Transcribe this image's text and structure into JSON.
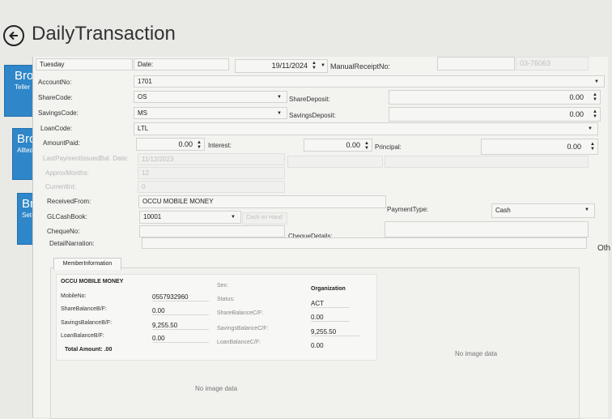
{
  "header": {
    "title": "DailyTransaction"
  },
  "tiles": [
    {
      "big": "Bro",
      "small": "Teller"
    },
    {
      "big": "Bro",
      "small": "Allted"
    },
    {
      "big": "Bro",
      "small": "Set-O"
    }
  ],
  "form": {
    "day": "Tuesday",
    "date_label": "Date:",
    "date_value": "19/11/2024",
    "manual_receipt_label": "ManualReceiptNo:",
    "manual_receipt_value": "",
    "receipt_ref": "03-76063",
    "account_label": "AccountNo:",
    "account_value": "1701",
    "share_code_label": "ShareCode:",
    "share_code_value": "OS",
    "share_deposit_label": "ShareDeposit:",
    "share_deposit_value": "0.00",
    "savings_code_label": "SavingsCode:",
    "savings_code_value": "MS",
    "savings_deposit_label": "SavingsDeposit:",
    "savings_deposit_value": "0.00",
    "loan_code_label": "LoanCode:",
    "loan_code_value": "LTL",
    "amount_paid_label": "AmountPaid:",
    "amount_paid_value": "0.00",
    "interest_label": "Interest:",
    "interest_value": "0.00",
    "principal_label": "Principal:",
    "principal_value": "0.00",
    "last_payment_label": "LastPaymentIssuedBal. Date:",
    "last_payment_value": "11/12/2023",
    "approx_months_label": "ApproxMonths:",
    "approx_months_value": "12",
    "current_int_label": "CurrentInt:",
    "current_int_value": "0",
    "received_from_label": "ReceivedFrom:",
    "received_from_value": "OCCU MOBILE MONEY",
    "cashbook_label": "GLCashBook:",
    "cashbook_value": "10001",
    "cashbook_btn": "Cash on Hand",
    "payment_type_label": "PaymentType:",
    "payment_type_value": "Cash",
    "cheque_no_label": "ChequeNo:",
    "cheque_details_label": "ChequeDetails:",
    "detail_narration_label": "DetailNarration:",
    "other_label": "Oth"
  },
  "member": {
    "tab_label": "MemberInformation",
    "name": "OCCU MOBILE MONEY",
    "mobile_label": "MobileNo:",
    "mobile_value": "0557932960",
    "share_bf_label": "ShareBalanceB/F:",
    "share_bf_value": "0.00",
    "savings_bf_label": "SavingsBalanceB/F:",
    "savings_bf_value": "9,255.50",
    "loan_bf_label": "LoanBalanceB/F:",
    "loan_bf_value": "0.00",
    "total_label": "Total Amount: .00",
    "sex_label": "Sex:",
    "status_label": "Status:",
    "share_cf_label": "ShareBalanceC/F:",
    "savings_cf_label": "SavingsBalanceC/F:",
    "loan_cf_label": "LoanBalanceC/F:",
    "organization_label": "Organization",
    "status_value": "ACT",
    "share_cf_value": "0.00",
    "savings_cf_value": "9,255.50",
    "loan_cf_value": "0.00",
    "no_image_1": "No image data",
    "no_image_2": "No image data"
  }
}
